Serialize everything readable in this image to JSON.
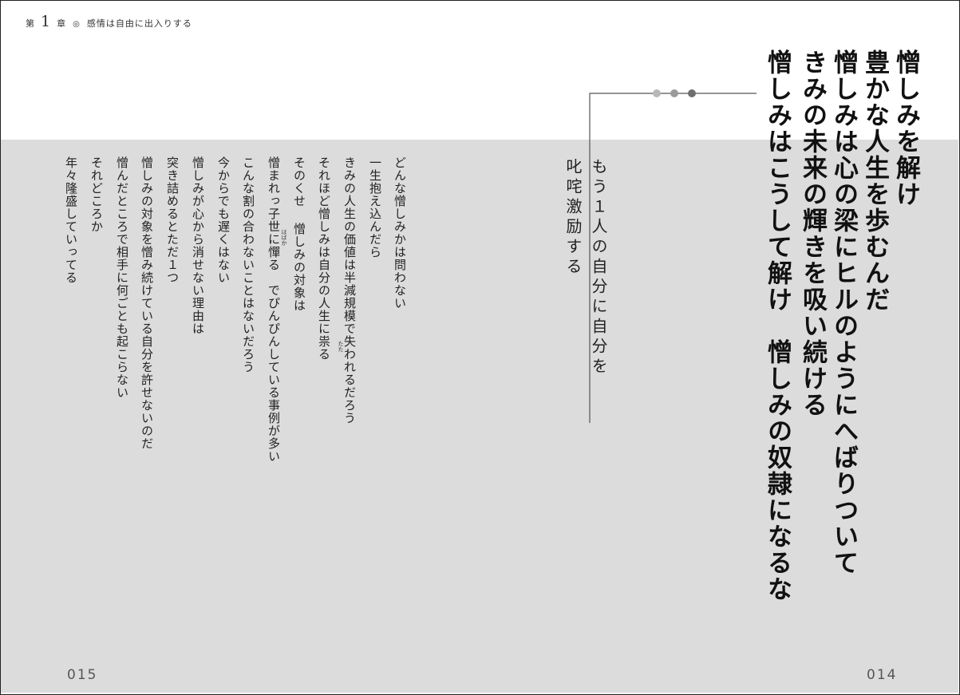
{
  "header": {
    "chapter_prefix": "第",
    "chapter_number": "1",
    "chapter_suffix": "章",
    "separator": "◎",
    "chapter_title": "感情は自由に出入りする"
  },
  "title_lines": [
    "憎しみを解け",
    "豊かな人生を歩むんだ",
    "憎しみは心の梁にヒルのようにへばりついて",
    "きみの未来の輝きを吸い続ける",
    "憎しみはこうして解け　憎しみの奴隷になるな"
  ],
  "subtitle_lines": [
    "もう１人の自分に自分を",
    "叱咤激励する"
  ],
  "body_lines": [
    "どんな憎しみかは問わない",
    "一生抱え込んだら",
    "きみの人生の価値は半減規模で失われるだろう",
    "それほど憎しみは自分の人生に祟る",
    "そのくせ 憎しみの対象は",
    "憎まれっ子世に憚る　でぴんぴんしている事例が多い",
    "こんな割の合わないことはないだろう",
    "今からでも遅くはない",
    "憎しみが心から消せない理由は",
    "突き詰めるとただ１つ",
    "憎しみの対象を憎み続けている自分を許せないのだ",
    "憎んだところで相手に何ごとも起こらない",
    "それどころか",
    "年々隆盛していってる"
  ],
  "ruby": {
    "tatari": "たた",
    "habakaru": "はばか"
  },
  "page_numbers": {
    "left": "015",
    "right": "014"
  },
  "colors": {
    "band": "#dcdcdc",
    "dot_light": "#b8b8b8",
    "dot_mid": "#9a9a9a",
    "dot_dark": "#6e6e6e",
    "rule": "#555555"
  }
}
